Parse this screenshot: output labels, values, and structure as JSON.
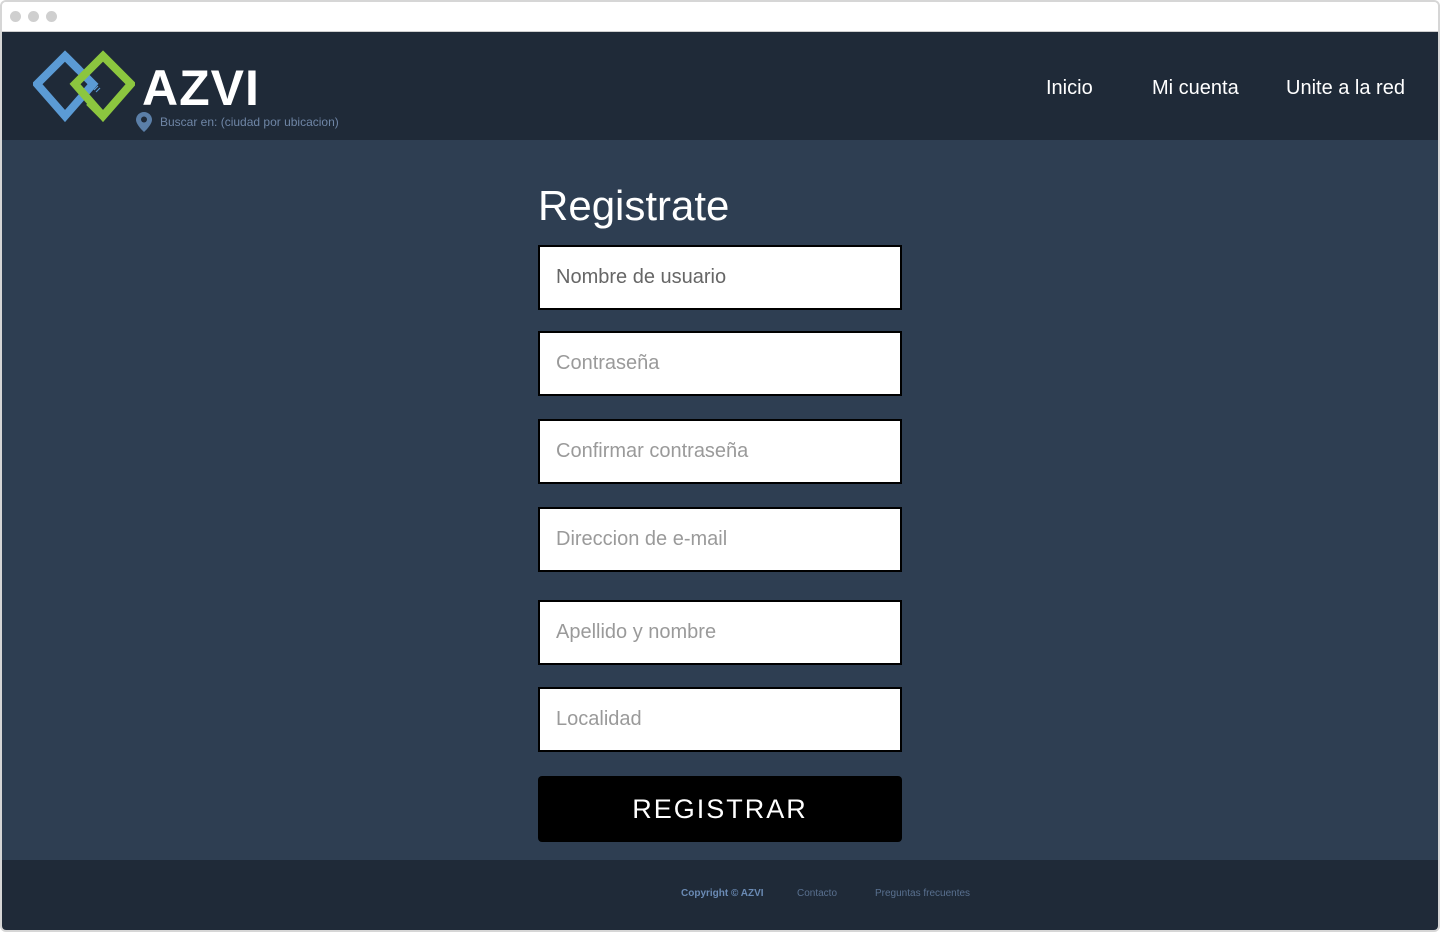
{
  "window": {
    "controls": [
      "close",
      "minimize",
      "maximize"
    ]
  },
  "header": {
    "brand": "AZVI",
    "logo_icon": "interlocking-diamonds-logo",
    "location_icon": "map-pin-icon",
    "location_text": "Buscar en: (ciudad por ubicacion)",
    "nav": [
      {
        "label": "Inicio"
      },
      {
        "label": "Mi cuenta"
      },
      {
        "label": "Unite a la red"
      }
    ]
  },
  "form": {
    "title": "Registrate",
    "fields": [
      {
        "placeholder": "Nombre de usuario",
        "value": ""
      },
      {
        "placeholder": "Contraseña",
        "value": ""
      },
      {
        "placeholder": "Confirmar contraseña",
        "value": ""
      },
      {
        "placeholder": "Direccion de e-mail",
        "value": ""
      },
      {
        "placeholder": "Apellido y nombre",
        "value": ""
      },
      {
        "placeholder": "Localidad",
        "value": ""
      }
    ],
    "submit_label": "REGISTRAR"
  },
  "footer": {
    "copyright": "Copyright © AZVI",
    "links": [
      "Contacto",
      "Preguntas frecuentes"
    ]
  },
  "colors": {
    "header_bg": "#1f2a38",
    "main_bg": "#2e3e52",
    "logo_blue": "#5b9bd5",
    "logo_green": "#8cc63f",
    "button_bg": "#000000"
  }
}
